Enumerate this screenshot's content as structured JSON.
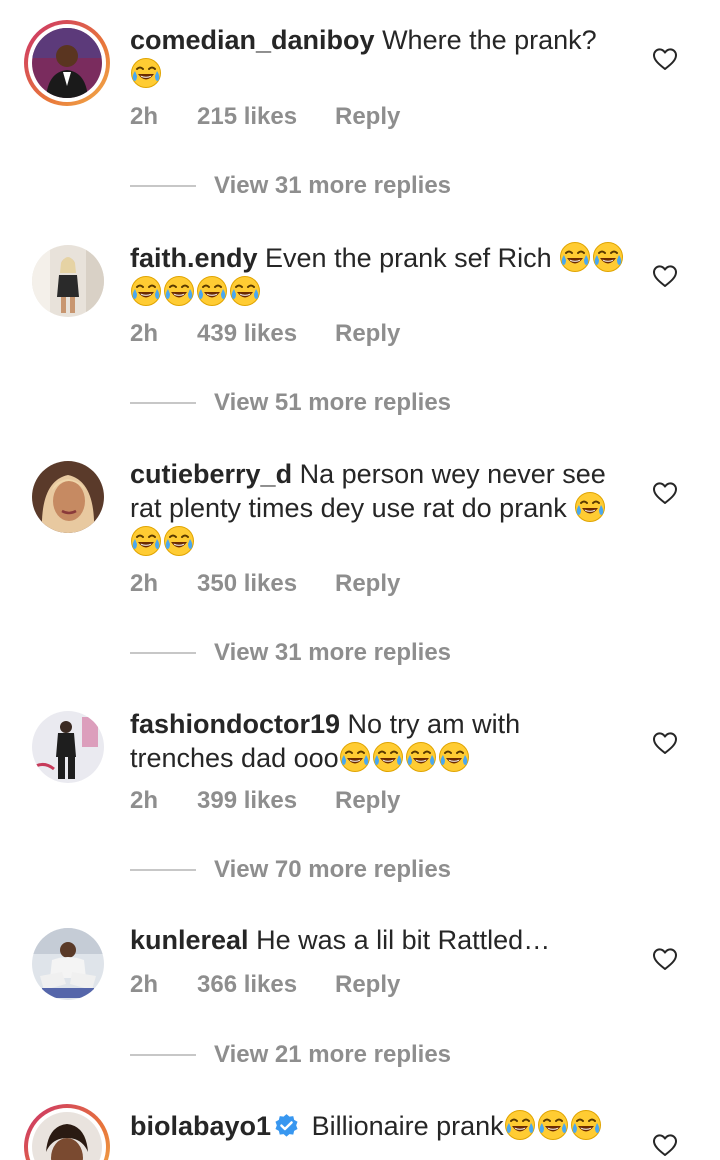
{
  "comments": [
    {
      "username": "comedian_daniboy",
      "text": "Where the prank?",
      "emoji_count": 1,
      "time": "2h",
      "likes": "215 likes",
      "reply": "Reply",
      "view_replies": "View 31 more replies",
      "has_story": true
    },
    {
      "username": "faith.endy",
      "text": "Even the prank sef Rich",
      "emoji_count": 6,
      "time": "2h",
      "likes": "439 likes",
      "reply": "Reply",
      "view_replies": "View 51 more replies"
    },
    {
      "username": "cutieberry_d",
      "text": "Na person wey never see rat plenty times dey use rat do prank",
      "emoji_count": 3,
      "time": "2h",
      "likes": "350 likes",
      "reply": "Reply",
      "view_replies": "View 31 more replies"
    },
    {
      "username": "fashiondoctor19",
      "text": "No try am with trenches dad ooo",
      "emoji_count": 4,
      "time": "2h",
      "likes": "399 likes",
      "reply": "Reply",
      "view_replies": "View 70 more replies"
    },
    {
      "username": "kunlereal",
      "text": "He was a lil bit Rattled…",
      "emoji_count": 0,
      "time": "2h",
      "likes": "366 likes",
      "reply": "Reply",
      "view_replies": "View 21 more replies"
    },
    {
      "username": "biolabayo1",
      "text": "Billionaire prank",
      "emoji_count": 3,
      "verified": true,
      "has_story": true
    }
  ],
  "icons": {
    "emoji": "face-with-tears-of-joy-icon",
    "heart": "heart-outline-icon",
    "verified": "verified-badge-icon"
  },
  "colors": {
    "text": "#262626",
    "secondary": "#8e8e8e",
    "verified": "#3897f0",
    "story_ring_start": "#c9306b",
    "story_ring_end": "#f2b04a"
  }
}
